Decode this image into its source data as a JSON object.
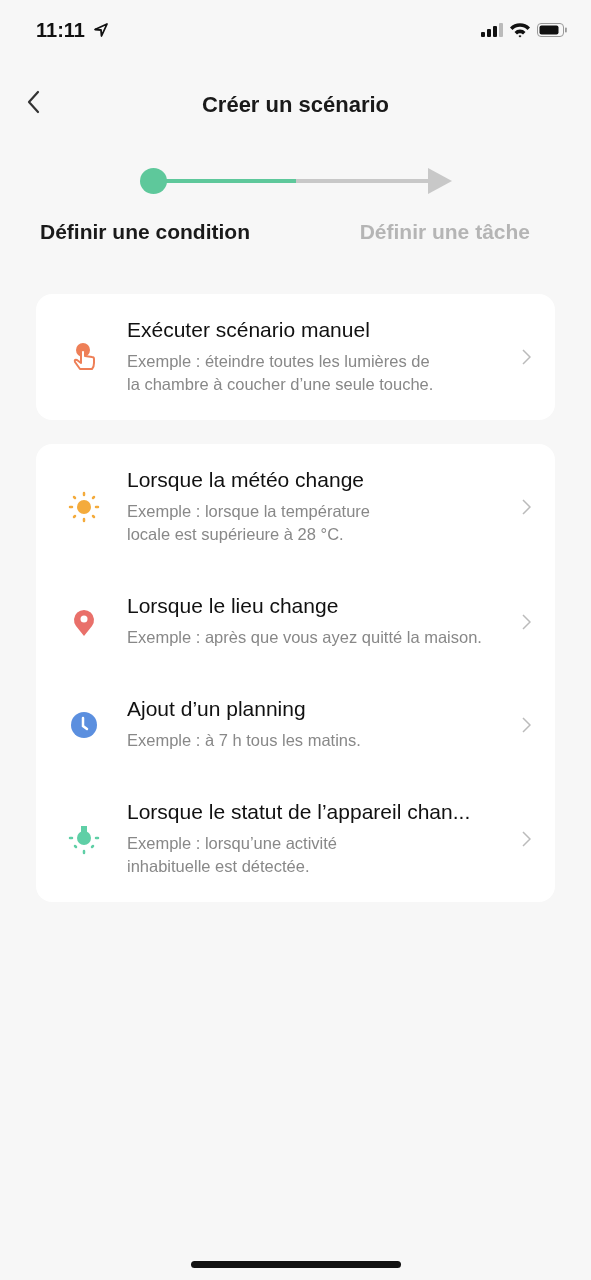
{
  "status_bar": {
    "time": "11:11"
  },
  "header": {
    "title": "Créer un scénario"
  },
  "stepper": {
    "level": 0.5,
    "steps": [
      {
        "label": "Définir une condition",
        "selected": true
      },
      {
        "label": "Définir une tâche",
        "selected": false
      }
    ]
  },
  "groups": [
    {
      "items": [
        {
          "kind": "manual",
          "color": "#ee7f57",
          "title": "Exécuter scénario manuel",
          "description": "Exemple : éteindre toutes les lumières de la chambre à coucher d’une seule touche."
        }
      ]
    },
    {
      "items": [
        {
          "kind": "weather",
          "color": "#f4ab3c",
          "title": "Lorsque la météo change",
          "description": "Exemple : lorsque la température locale est supérieure à 28 °C."
        },
        {
          "kind": "location",
          "color": "#e9706a",
          "title": "Lorsque le lieu change",
          "description": "Exemple : après que vous ayez quitté la maison."
        },
        {
          "kind": "schedule",
          "color": "#5b8fdf",
          "title": "Ajout d’un planning",
          "description": "Exemple : à 7 h tous les matins."
        },
        {
          "kind": "device",
          "color": "#5fcfa6",
          "title": "Lorsque le statut de l’appareil chan...",
          "description": "Exemple : lorsqu’une activité inhabituelle est détectée."
        }
      ]
    }
  ]
}
